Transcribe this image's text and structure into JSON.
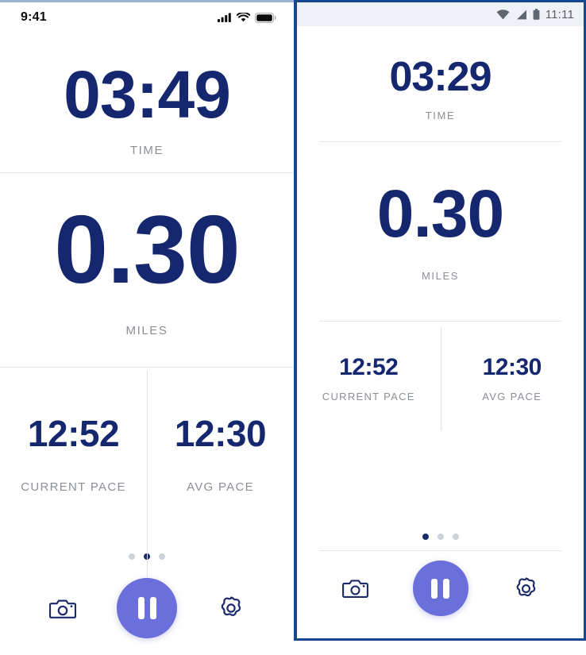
{
  "app": {
    "name": "Run Tracker",
    "accent_navy": "#15276e",
    "accent_periwinkle": "#6b6fdc",
    "label_gray": "#8b8f96",
    "divider_gray": "#e3e4e8",
    "frame_blue": "#17478f"
  },
  "ios_phone": {
    "platform": "iOS",
    "status_bar": {
      "clock": "9:41",
      "icons": [
        "cellular-signal-icon",
        "wifi-icon",
        "battery-icon"
      ]
    },
    "metrics": {
      "time": {
        "value": "03:49",
        "label": "TIME"
      },
      "distance": {
        "value": "0.30",
        "label": "MILES"
      },
      "current_pace": {
        "value": "12:52",
        "label": "CURRENT PACE"
      },
      "avg_pace": {
        "value": "12:30",
        "label": "AVG PACE"
      }
    },
    "page_dots": {
      "count": 3,
      "active_index": 1
    },
    "bottom_bar": {
      "camera_label": "camera-icon",
      "pause_label": "pause-icon",
      "settings_label": "gear-icon"
    }
  },
  "android_phone": {
    "platform": "Android",
    "status_bar": {
      "clock": "11:11",
      "icons": [
        "wifi-icon",
        "cellular-signal-icon",
        "battery-icon"
      ]
    },
    "metrics": {
      "time": {
        "value": "03:29",
        "label": "TIME"
      },
      "distance": {
        "value": "0.30",
        "label": "MILES"
      },
      "current_pace": {
        "value": "12:52",
        "label": "CURRENT PACE"
      },
      "avg_pace": {
        "value": "12:30",
        "label": "AVG PACE"
      }
    },
    "page_dots": {
      "count": 3,
      "active_index": 0
    },
    "bottom_bar": {
      "camera_label": "camera-icon",
      "pause_label": "pause-icon",
      "settings_label": "gear-icon"
    }
  }
}
